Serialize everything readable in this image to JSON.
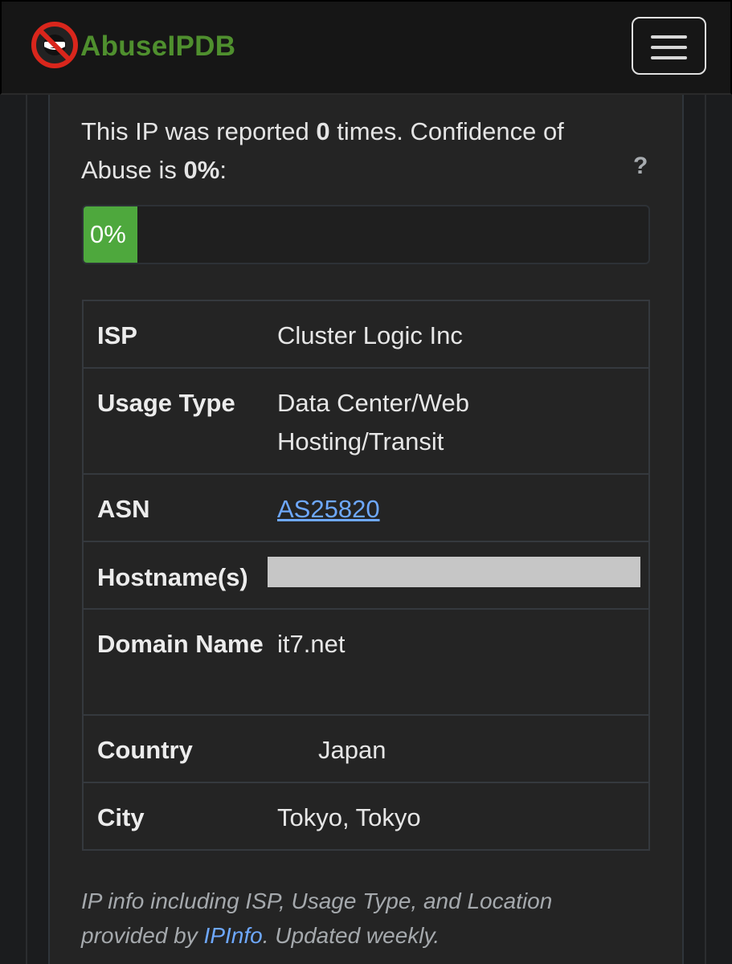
{
  "nav": {
    "brand": "AbuseIPDB",
    "logo_icon": "no-abuse-logo-icon",
    "menu_icon": "hamburger-menu-icon"
  },
  "summary": {
    "text_before_count": "This IP was reported ",
    "report_count": "0",
    "text_after_count": " times. Confidence of Abuse is ",
    "confidence": "0%",
    "text_end": ":",
    "help_icon": "?"
  },
  "confidence_bar": {
    "label": "0%",
    "value_percent": 0,
    "color": "#4ea83d"
  },
  "ip_info": {
    "isp": {
      "label": "ISP",
      "value": "Cluster Logic Inc"
    },
    "usage_type": {
      "label": "Usage Type",
      "value": "Data Center/Web Hosting/Transit"
    },
    "asn": {
      "label": "ASN",
      "value": "AS25820"
    },
    "hostnames": {
      "label": "Hostname(s)",
      "value": ""
    },
    "domain": {
      "label": "Domain Name",
      "value": "it7.net"
    },
    "country": {
      "label": "Country",
      "value": "Japan"
    },
    "city": {
      "label": "City",
      "value": "Tokyo, Tokyo"
    }
  },
  "footer": {
    "text_before": "IP info including ISP, Usage Type, and Location provided by ",
    "link": "IPInfo",
    "text_after": ". Updated weekly."
  },
  "colors": {
    "brand_green": "#4f8f2e",
    "link_blue": "#6ea8ff",
    "background": "#1b1c1e",
    "panel": "#242424"
  }
}
